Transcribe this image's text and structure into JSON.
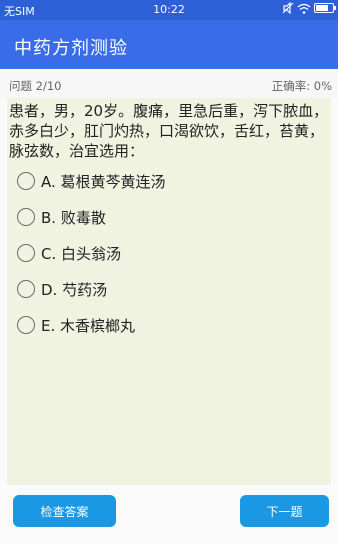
{
  "status_bar": {
    "carrier": "无SIM",
    "time": "10:22"
  },
  "app_bar": {
    "title": "中药方剂测验"
  },
  "progress": {
    "question_counter": "问题 2/10",
    "accuracy": "正确率: 0%"
  },
  "question": {
    "text": "患者，男，20岁。腹痛，里急后重，泻下脓血，赤多白少，肛门灼热，口渴欲饮，舌红，苔黄，脉弦数，治宜选用："
  },
  "options": [
    {
      "label": "A. 葛根黄芩黄连汤",
      "selected": false
    },
    {
      "label": "B. 败毒散",
      "selected": false
    },
    {
      "label": "C. 白头翁汤",
      "selected": false
    },
    {
      "label": "D. 芍药汤",
      "selected": false
    },
    {
      "label": "E. 木香槟榔丸",
      "selected": false
    }
  ],
  "buttons": {
    "check_answer": "检查答案",
    "next": "下一题"
  },
  "colors": {
    "status_bar": "#2d5fd6",
    "app_bar": "#3a6be8",
    "card_background": "#f1f3e1",
    "button": "#1a98e4"
  }
}
